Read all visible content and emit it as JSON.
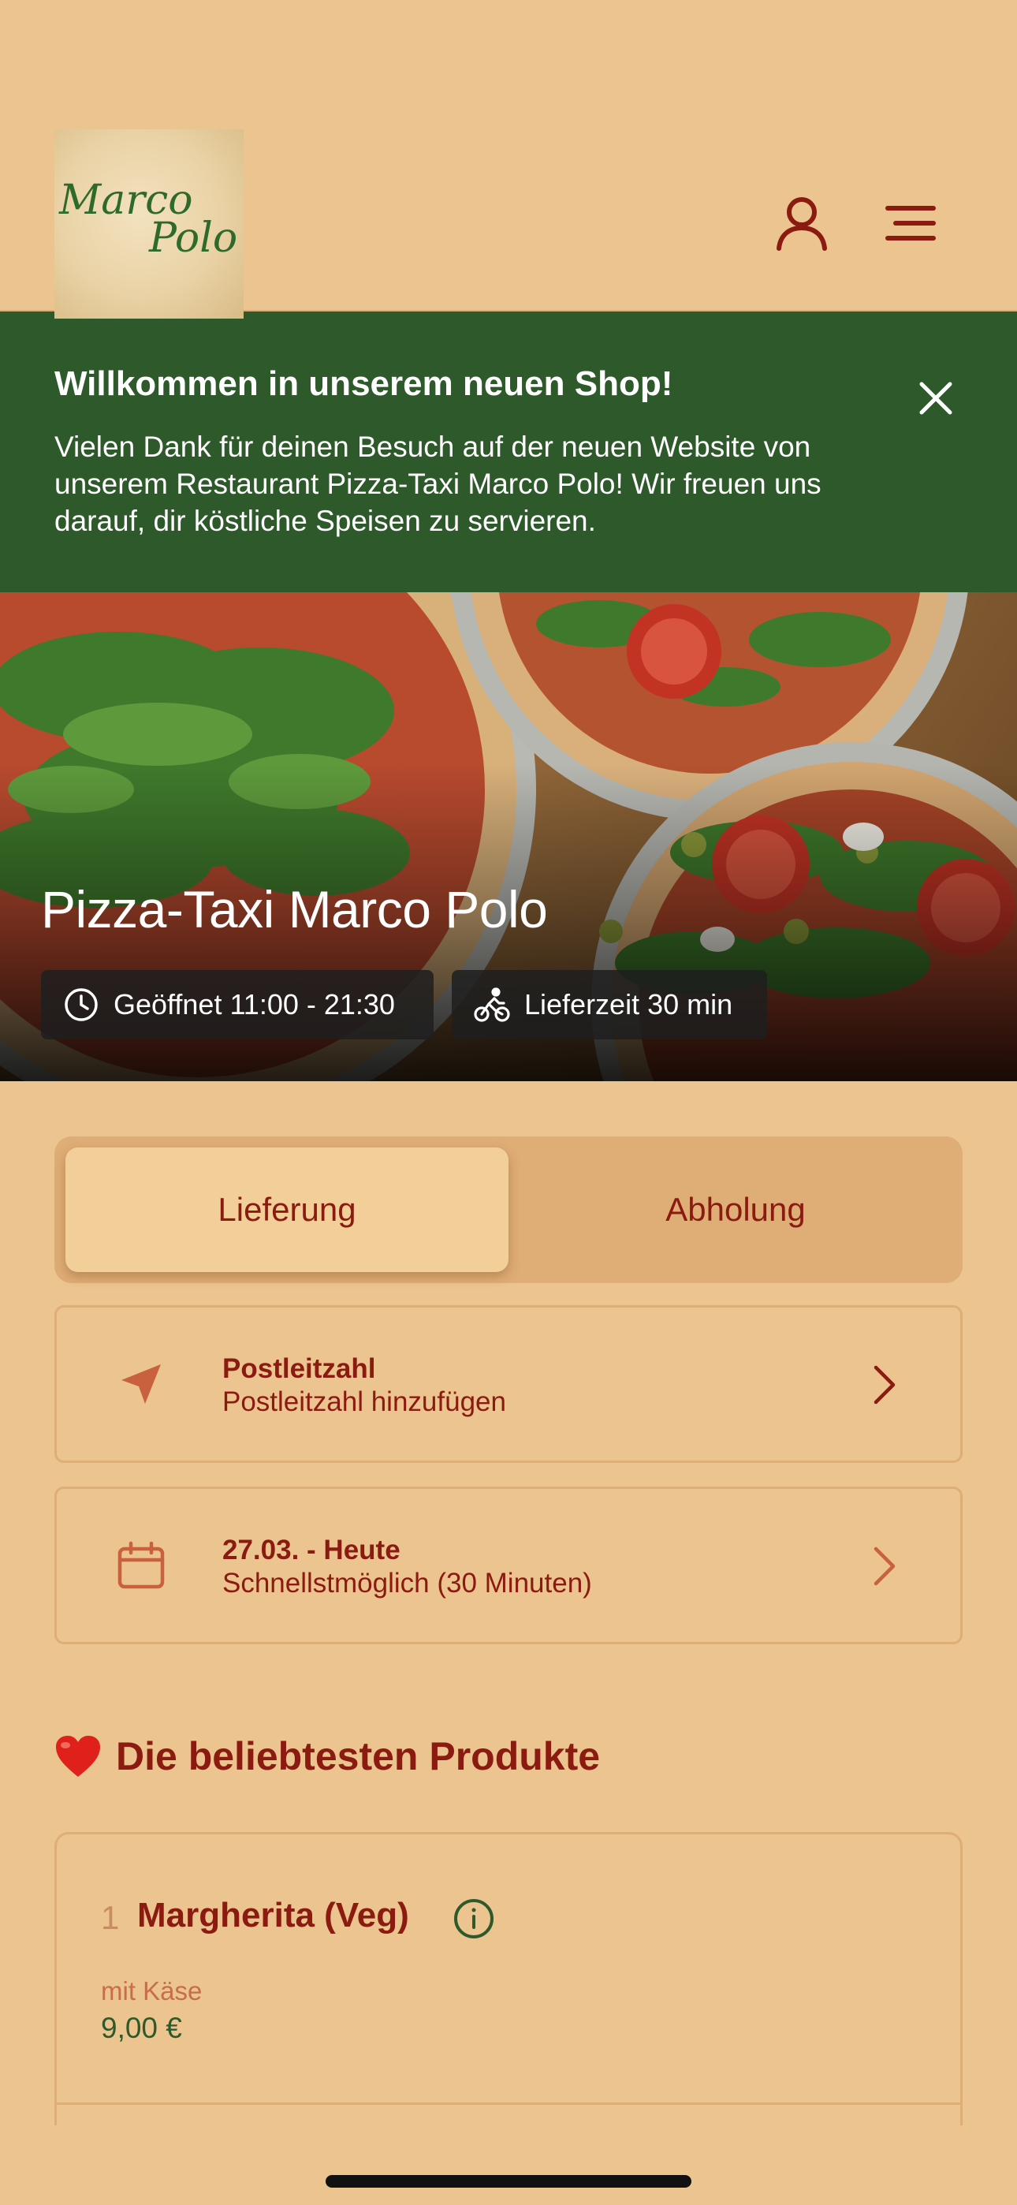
{
  "header": {
    "logo": {
      "line1": "Marco",
      "line2": "Polo"
    },
    "icons": {
      "user": "user-icon",
      "menu": "menu-icon"
    }
  },
  "banner": {
    "title": "Willkommen in unserem neuen Shop!",
    "text": "Vielen Dank für deinen Besuch auf der neuen Website von unserem Restaurant Pizza-Taxi Marco Polo! Wir freuen uns darauf, dir köstliche Speisen zu servieren.",
    "close_icon": "close-icon"
  },
  "hero": {
    "title": "Pizza-Taxi Marco Polo",
    "opening_hours": "Geöffnet 11:00 - 21:30",
    "delivery_time": "Lieferzeit 30 min"
  },
  "mode_toggle": {
    "options": [
      "Lieferung",
      "Abholung"
    ],
    "selected": "Lieferung"
  },
  "postal_code": {
    "title": "Postleitzahl",
    "subtitle": "Postleitzahl hinzufügen"
  },
  "date": {
    "title": "27.03. - Heute",
    "subtitle": "Schnellstmöglich (30 Minuten)"
  },
  "popular": {
    "title": "Die beliebtesten Produkte",
    "items": [
      {
        "number": "1",
        "name": "Margherita (Veg)",
        "description": "mit Käse",
        "price": "9,00 €"
      }
    ]
  },
  "colors": {
    "background": "#EBC48F",
    "primary": "#8B1A10",
    "banner": "#2E5A2B",
    "price": "#2E5A2B"
  }
}
